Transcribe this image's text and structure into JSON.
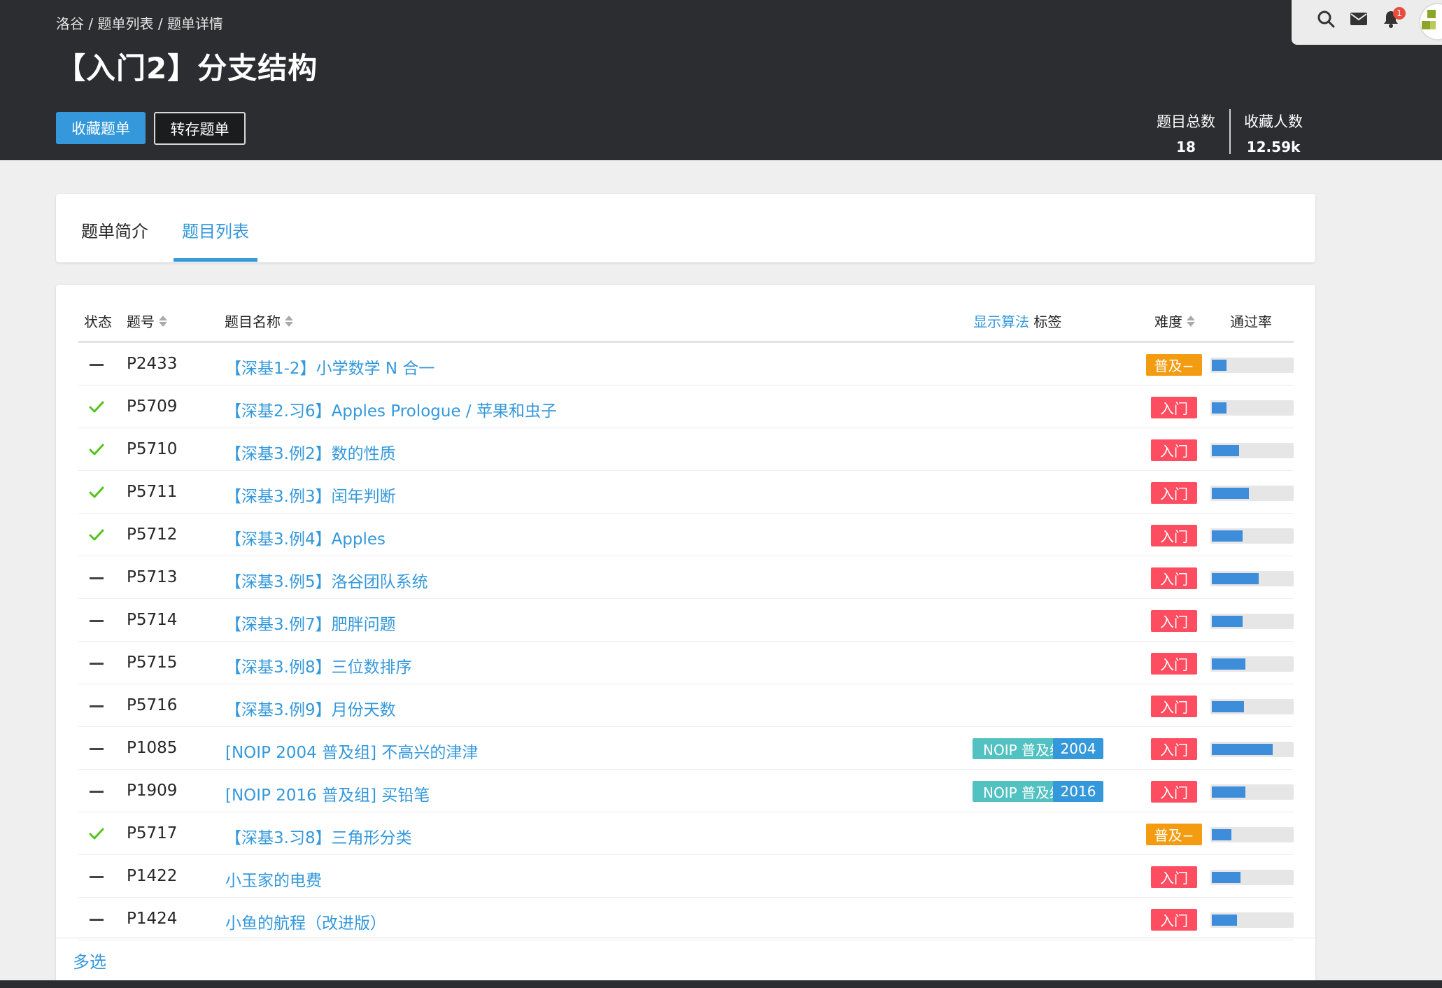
{
  "breadcrumb": [
    "洛谷",
    "/",
    "题单列表",
    "/",
    "题单详情"
  ],
  "title": "【入门2】分支结构",
  "buttons": {
    "favorite": "收藏题单",
    "save": "转存题单"
  },
  "stats": {
    "total_label": "题目总数",
    "total_value": "18",
    "fav_label": "收藏人数",
    "fav_value": "12.59k"
  },
  "user_bar": {
    "notification_count": "1"
  },
  "tabs": {
    "intro": "题单简介",
    "list": "题目列表"
  },
  "table": {
    "headers": {
      "status": "状态",
      "pid": "题号",
      "name": "题目名称",
      "show_algo": "显示算法",
      "tags": "标签",
      "difficulty": "难度",
      "pass_rate": "通过率"
    },
    "rows": [
      {
        "solved": false,
        "pid": "P2433",
        "name": "【深基1-2】小学数学 N 合一",
        "tags": [],
        "difficulty": "普及−",
        "diff_color": "#f39c11",
        "pass_rate": 0.18
      },
      {
        "solved": true,
        "pid": "P5709",
        "name": "【深基2.习6】Apples Prologue / 苹果和虫子",
        "tags": [],
        "difficulty": "入门",
        "diff_color": "#fe4c61",
        "pass_rate": 0.18
      },
      {
        "solved": true,
        "pid": "P5710",
        "name": "【深基3.例2】数的性质",
        "tags": [],
        "difficulty": "入门",
        "diff_color": "#fe4c61",
        "pass_rate": 0.34
      },
      {
        "solved": true,
        "pid": "P5711",
        "name": "【深基3.例3】闰年判断",
        "tags": [],
        "difficulty": "入门",
        "diff_color": "#fe4c61",
        "pass_rate": 0.46
      },
      {
        "solved": true,
        "pid": "P5712",
        "name": "【深基3.例4】Apples",
        "tags": [],
        "difficulty": "入门",
        "diff_color": "#fe4c61",
        "pass_rate": 0.38
      },
      {
        "solved": false,
        "pid": "P5713",
        "name": "【深基3.例5】洛谷团队系统",
        "tags": [],
        "difficulty": "入门",
        "diff_color": "#fe4c61",
        "pass_rate": 0.58
      },
      {
        "solved": false,
        "pid": "P5714",
        "name": "【深基3.例7】肥胖问题",
        "tags": [],
        "difficulty": "入门",
        "diff_color": "#fe4c61",
        "pass_rate": 0.38
      },
      {
        "solved": false,
        "pid": "P5715",
        "name": "【深基3.例8】三位数排序",
        "tags": [],
        "difficulty": "入门",
        "diff_color": "#fe4c61",
        "pass_rate": 0.42
      },
      {
        "solved": false,
        "pid": "P5716",
        "name": "【深基3.例9】月份天数",
        "tags": [],
        "difficulty": "入门",
        "diff_color": "#fe4c61",
        "pass_rate": 0.4
      },
      {
        "solved": false,
        "pid": "P1085",
        "name": "[NOIP 2004 普及组] 不高兴的津津",
        "tags": [
          {
            "text": "NOIP 普及组",
            "color": "#52c1c1"
          },
          {
            "text": "2004",
            "color": "#3498db"
          }
        ],
        "difficulty": "入门",
        "diff_color": "#fe4c61",
        "pass_rate": 0.76
      },
      {
        "solved": false,
        "pid": "P1909",
        "name": "[NOIP 2016 普及组] 买铅笔",
        "tags": [
          {
            "text": "NOIP 普及组",
            "color": "#52c1c1"
          },
          {
            "text": "2016",
            "color": "#3498db"
          }
        ],
        "difficulty": "入门",
        "diff_color": "#fe4c61",
        "pass_rate": 0.42
      },
      {
        "solved": true,
        "pid": "P5717",
        "name": "【深基3.习8】三角形分类",
        "tags": [],
        "difficulty": "普及−",
        "diff_color": "#f39c11",
        "pass_rate": 0.24
      },
      {
        "solved": false,
        "pid": "P1422",
        "name": "小玉家的电费",
        "tags": [],
        "difficulty": "入门",
        "diff_color": "#fe4c61",
        "pass_rate": 0.36
      },
      {
        "solved": false,
        "pid": "P1424",
        "name": "小鱼的航程（改进版）",
        "tags": [],
        "difficulty": "入门",
        "diff_color": "#fe4c61",
        "pass_rate": 0.31
      }
    ]
  },
  "multi_select": "多选",
  "colors": {
    "header_bg": "#2b2d30",
    "accent": "#3498db",
    "solved": "#52c41a"
  }
}
